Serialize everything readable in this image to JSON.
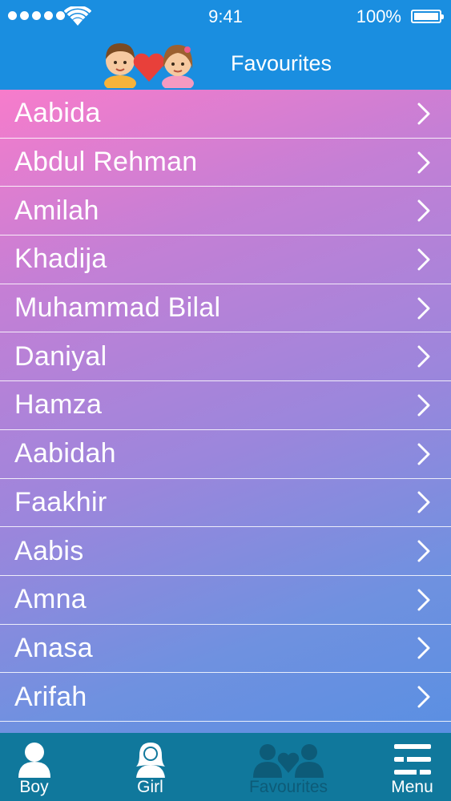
{
  "status": {
    "time": "9:41",
    "battery": "100%"
  },
  "header": {
    "title": "Favourites",
    "logo": "boy-girl-heart-logo"
  },
  "favourites": [
    {
      "name": "Aabida"
    },
    {
      "name": "Abdul Rehman"
    },
    {
      "name": "Amilah"
    },
    {
      "name": "Khadija"
    },
    {
      "name": "Muhammad Bilal"
    },
    {
      "name": "Daniyal"
    },
    {
      "name": "Hamza"
    },
    {
      "name": "Aabidah"
    },
    {
      "name": "Faakhir"
    },
    {
      "name": "Aabis"
    },
    {
      "name": "Amna"
    },
    {
      "name": "Anasa"
    },
    {
      "name": "Arifah"
    }
  ],
  "tabs": [
    {
      "label": "Boy",
      "icon": "boy-icon"
    },
    {
      "label": "Girl",
      "icon": "girl-icon"
    },
    {
      "label": "Favourites",
      "icon": "favourites-icon",
      "active": true
    },
    {
      "label": "Menu",
      "icon": "menu-icon"
    }
  ],
  "colors": {
    "bar": "#1a8ee0",
    "tab_bar": "#10789c",
    "active_tab": "#0d5b78",
    "gradient_start": "#f77ccb",
    "gradient_end": "#5a8fe2"
  }
}
